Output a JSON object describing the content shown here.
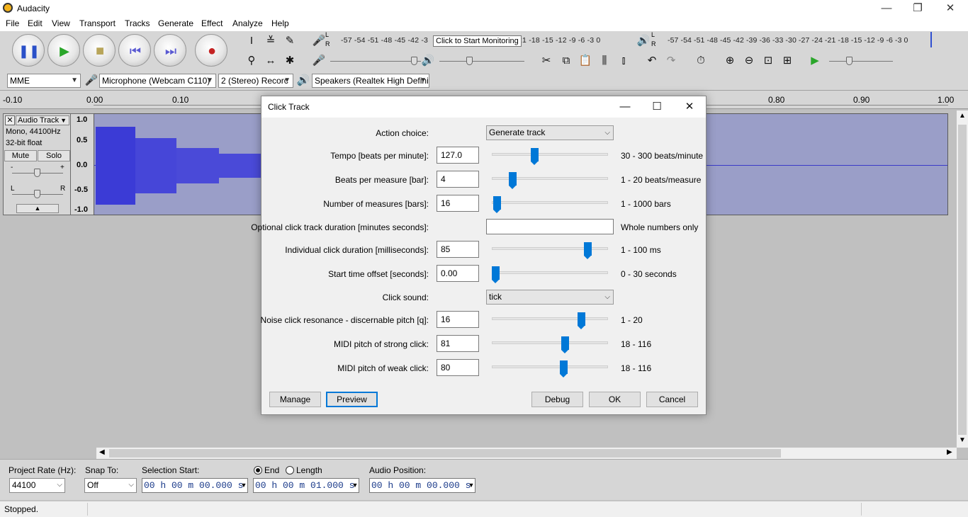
{
  "window": {
    "title": "Audacity",
    "minimize_glyph": "—",
    "restore_glyph": "❐",
    "close_glyph": "✕"
  },
  "menu": [
    "File",
    "Edit",
    "View",
    "Transport",
    "Tracks",
    "Generate",
    "Effect",
    "Analyze",
    "Help"
  ],
  "meters": {
    "record_scale": "-57 -54 -51 -48 -45 -42 -3",
    "record_scale_tail": "21 -18 -15 -12 -9 -6 -3 0",
    "record_tooltip": "Click to Start Monitoring",
    "play_scale": "-57 -54 -51 -48 -45 -42 -39 -36 -33 -30 -27 -24 -21 -18 -15 -12 -9 -6 -3 0",
    "left_channel": "L",
    "right_channel": "R"
  },
  "devices": {
    "host": "MME",
    "input": "Microphone (Webcam C110)",
    "channels": "2 (Stereo) Recorc",
    "output": "Speakers (Realtek High Defini"
  },
  "ruler": {
    "labels": [
      "-0.10",
      "0.00",
      "0.10",
      "0.80",
      "0.90",
      "1.00"
    ]
  },
  "track": {
    "name": "Audio Track",
    "info1": "Mono, 44100Hz",
    "info2": "32-bit float",
    "mute": "Mute",
    "solo": "Solo",
    "scale": [
      "1.0",
      "0.5",
      "0.0",
      "-0.5",
      "-1.0"
    ],
    "gain_minus": "-",
    "gain_plus": "+",
    "pan_left": "L",
    "pan_right": "R"
  },
  "selection_bar": {
    "project_rate_label": "Project Rate (Hz):",
    "project_rate": "44100",
    "snap_label": "Snap To:",
    "snap_value": "Off",
    "selection_start_label": "Selection Start:",
    "selection_start": "00 h 00 m 00.000 s",
    "end_label": "End",
    "length_label": "Length",
    "end_value": "00 h 00 m 01.000 s",
    "audio_position_label": "Audio Position:",
    "audio_position": "00 h 00 m 00.000 s"
  },
  "status": {
    "text": "Stopped."
  },
  "dialog": {
    "title": "Click Track",
    "params": [
      {
        "label": "Action choice:",
        "type": "choice",
        "value": "Generate track"
      },
      {
        "label": "Tempo [beats per minute]:",
        "type": "slider",
        "value": "127.0",
        "range": "30 - 300 beats/minute",
        "level": 0.36
      },
      {
        "label": "Beats per measure [bar]:",
        "type": "slider",
        "value": "4",
        "range": "1 - 20 beats/measure",
        "level": 0.16
      },
      {
        "label": "Number of measures [bars]:",
        "type": "slider",
        "value": "16",
        "range": "1 - 1000 bars",
        "level": 0.015
      },
      {
        "label": "Optional click track duration [minutes seconds]:",
        "type": "text",
        "value": "",
        "range": "Whole numbers only"
      },
      {
        "label": "Individual click duration [milliseconds]:",
        "type": "slider",
        "value": "85",
        "range": "1 - 100 ms",
        "level": 0.85
      },
      {
        "label": "Start time offset [seconds]:",
        "type": "slider",
        "value": "0.00",
        "range": "0 - 30 seconds",
        "level": 0.0
      },
      {
        "label": "Click sound:",
        "type": "choice",
        "value": "tick"
      },
      {
        "label": "Noise click resonance - discernable pitch [q]:",
        "type": "slider",
        "value": "16",
        "range": "1 - 20",
        "level": 0.79
      },
      {
        "label": "MIDI pitch of strong click:",
        "type": "slider",
        "value": "81",
        "range": "18 - 116",
        "level": 0.64
      },
      {
        "label": "MIDI pitch of weak click:",
        "type": "slider",
        "value": "80",
        "range": "18 - 116",
        "level": 0.63
      }
    ],
    "buttons": {
      "manage": "Manage",
      "preview": "Preview",
      "debug": "Debug",
      "ok": "OK",
      "cancel": "Cancel"
    }
  }
}
